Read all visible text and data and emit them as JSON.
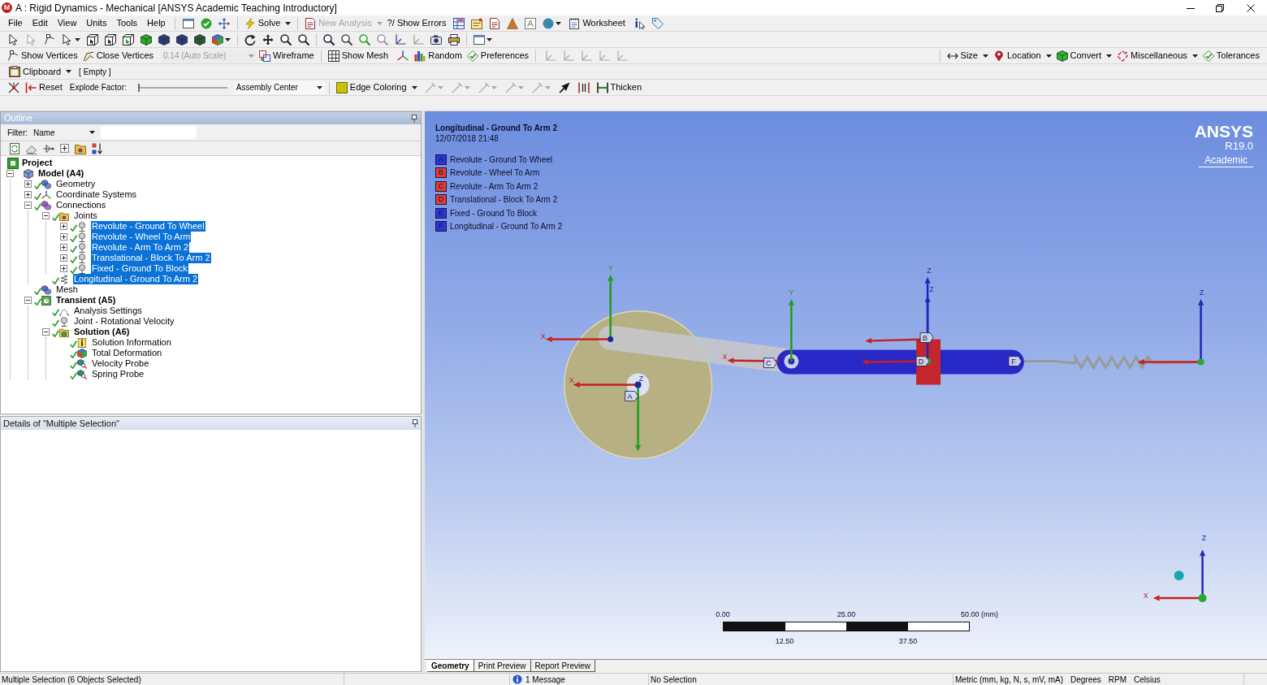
{
  "window": {
    "icon_letter": "M",
    "title": "A : Rigid Dynamics - Mechanical [ANSYS Academic Teaching Introductory]"
  },
  "menu": [
    "File",
    "Edit",
    "View",
    "Units",
    "Tools",
    "Help"
  ],
  "standard_toolbar": [
    {
      "label": "Solve",
      "dropdown": true,
      "disabled": false
    },
    {
      "label": "New Analysis",
      "dropdown": true,
      "disabled": true
    },
    {
      "label": "?/ Show Errors",
      "dropdown": false,
      "disabled": false
    },
    {
      "label": "Worksheet",
      "dropdown": false,
      "disabled": false
    }
  ],
  "graphics_options_toolbar": {
    "show_vertices": "Show Vertices",
    "close_vertices": "Close Vertices",
    "scale": {
      "value": "0.14 (Auto Scale)",
      "disabled": true
    },
    "wireframe": "Wireframe",
    "show_mesh": "Show Mesh",
    "random": "Random",
    "preferences": "Preferences"
  },
  "geometry_toolbar": [
    {
      "label": "Size",
      "dropdown": true
    },
    {
      "label": "Location",
      "dropdown": true
    },
    {
      "label": "Convert",
      "dropdown": true
    },
    {
      "label": "Miscellaneous",
      "dropdown": true
    },
    {
      "label": "Tolerances",
      "dropdown": false
    }
  ],
  "clipboard_toolbar": {
    "label": "Clipboard",
    "contents": "[ Empty ]"
  },
  "explode_toolbar": {
    "reset": "Reset",
    "explode_label": "Explode Factor:",
    "explode_slider": {
      "level": 0
    },
    "center": "Assembly Center",
    "edge_coloring": "Edge Coloring",
    "thicken": "Thicken"
  },
  "outline": {
    "title": "Outline",
    "filter_label": "Filter:",
    "filter_by": "Name",
    "tree": [
      {
        "label": "Project",
        "kind": "project",
        "bold": true,
        "selected": false,
        "children": [
          {
            "label": "Model (A4)",
            "kind": "model",
            "bold": true,
            "expanded": true,
            "selected": false,
            "children": [
              {
                "label": "Geometry",
                "kind": "geometry",
                "expanded": false,
                "complete": true,
                "selected": false
              },
              {
                "label": "Coordinate Systems",
                "kind": "coordinate_systems",
                "expanded": false,
                "complete": true,
                "selected": false
              },
              {
                "label": "Connections",
                "kind": "connections",
                "expanded": true,
                "complete": true,
                "selected": false,
                "children": [
                  {
                    "label": "Joints",
                    "kind": "joints",
                    "expanded": true,
                    "complete": true,
                    "selected": false,
                    "children": [
                      {
                        "label": "Revolute - Ground To Wheel",
                        "kind": "joint",
                        "expanded": false,
                        "complete": true,
                        "selected": true
                      },
                      {
                        "label": "Revolute - Wheel To Arm",
                        "kind": "joint",
                        "expanded": false,
                        "complete": true,
                        "selected": true
                      },
                      {
                        "label": "Revolute - Arm To Arm 2",
                        "kind": "joint",
                        "expanded": false,
                        "complete": true,
                        "selected": true
                      },
                      {
                        "label": "Translational - Block To Arm 2",
                        "kind": "joint",
                        "expanded": false,
                        "complete": true,
                        "selected": true
                      },
                      {
                        "label": "Fixed - Ground To Block",
                        "kind": "joint",
                        "expanded": false,
                        "complete": true,
                        "selected": true
                      }
                    ]
                  },
                  {
                    "label": "Longitudinal - Ground To Arm 2",
                    "kind": "spring",
                    "complete": true,
                    "selected": true
                  }
                ]
              },
              {
                "label": "Mesh",
                "kind": "mesh",
                "complete": true,
                "selected": false
              },
              {
                "label": "Transient (A5)",
                "kind": "transient",
                "bold": true,
                "expanded": true,
                "complete": true,
                "selected": false,
                "children": [
                  {
                    "label": "Analysis Settings",
                    "kind": "analysis_settings",
                    "complete": true,
                    "selected": false
                  },
                  {
                    "label": "Joint - Rotational Velocity",
                    "kind": "joint_load",
                    "complete": true,
                    "selected": false
                  },
                  {
                    "label": "Solution (A6)",
                    "kind": "solution",
                    "bold": true,
                    "expanded": true,
                    "complete": true,
                    "selected": false,
                    "children": [
                      {
                        "label": "Solution Information",
                        "kind": "solution_information",
                        "complete": true,
                        "selected": false
                      },
                      {
                        "label": "Total Deformation",
                        "kind": "result",
                        "complete": true,
                        "selected": false
                      },
                      {
                        "label": "Velocity Probe",
                        "kind": "probe",
                        "complete": true,
                        "selected": false
                      },
                      {
                        "label": "Spring Probe",
                        "kind": "probe",
                        "complete": true,
                        "selected": false
                      }
                    ]
                  }
                ]
              }
            ]
          }
        ]
      }
    ]
  },
  "details": {
    "title": "Details of \"Multiple Selection\""
  },
  "viewport": {
    "title": "Longitudinal - Ground To Arm 2",
    "timestamp": "12/07/2018 21:48",
    "legend": [
      {
        "letter": "A",
        "label": "Revolute - Ground To Wheel",
        "color": "#2b37d4"
      },
      {
        "letter": "B",
        "label": "Revolute - Wheel To Arm",
        "color": "#e23d2e"
      },
      {
        "letter": "C",
        "label": "Revolute - Arm To Arm 2",
        "color": "#e23d2e"
      },
      {
        "letter": "D",
        "label": "Translational - Block To Arm 2",
        "color": "#e23d2e"
      },
      {
        "letter": "E",
        "label": "Fixed - Ground To Block",
        "color": "#2b37d4"
      },
      {
        "letter": "F",
        "label": "Longitudinal - Ground To Arm 2",
        "color": "#2b37d4"
      }
    ],
    "logo": {
      "name": "ANSYS",
      "version": "R19.0",
      "edition": "Academic"
    },
    "axis_labels": [
      "Y",
      "X",
      "X",
      "Z",
      "Y",
      "X",
      "Z",
      "Z",
      "Z"
    ],
    "joint_markers": [
      "A",
      "B",
      "C",
      "D",
      "F"
    ],
    "global_axes": [
      "Z",
      "X"
    ],
    "scale_bar": {
      "top_labels": [
        "0.00",
        "25.00",
        "50.00 (mm)"
      ],
      "bottom_labels": [
        "12.50",
        "37.50"
      ]
    }
  },
  "view_tabs": [
    {
      "label": "Geometry",
      "selected": true
    },
    {
      "label": "Print Preview",
      "selected": false
    },
    {
      "label": "Report Preview",
      "selected": false
    }
  ],
  "status_bar": {
    "selection": "Multiple Selection (6 Objects Selected)",
    "messages": "1 Message",
    "selection_detail": "No Selection",
    "units": "Metric (mm, kg, N, s, mV, mA)",
    "angle_unit": "Degrees",
    "speed_unit": "RPM",
    "temperature_unit": "Celsius"
  }
}
